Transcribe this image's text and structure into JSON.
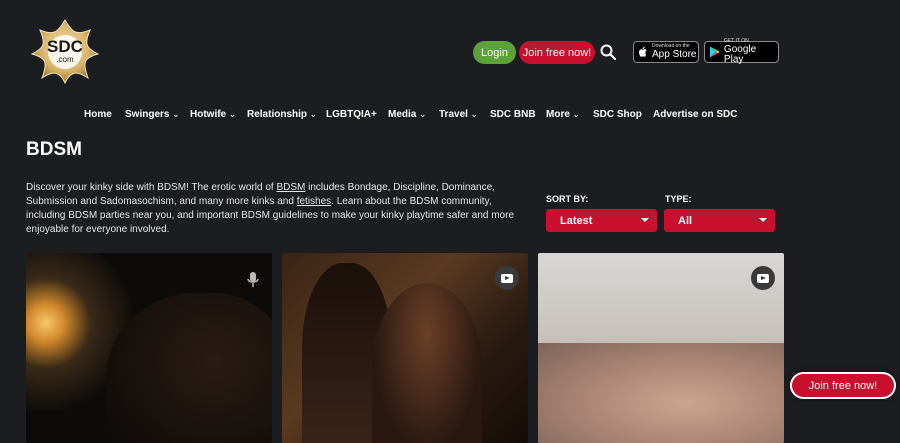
{
  "header": {
    "logo_text": "SDC",
    "logo_sub": ".com",
    "login_label": "Login",
    "join_label": "Join free now!",
    "app_store_small": "Download on the",
    "app_store_big": "App Store",
    "google_play_small": "GET IT ON",
    "google_play_big": "Google Play"
  },
  "nav": {
    "items": [
      {
        "label": "Home",
        "chevron": ""
      },
      {
        "label": "Swingers",
        "chevron": "⌄"
      },
      {
        "label": "Hotwife",
        "chevron": "⌄"
      },
      {
        "label": "Relationship",
        "chevron": "⌄"
      },
      {
        "label": "LGBTQIA+",
        "chevron": ""
      },
      {
        "label": "Media",
        "chevron": "⌄"
      },
      {
        "label": "Travel",
        "chevron": "⌄"
      },
      {
        "label": "SDC BNB",
        "chevron": ""
      },
      {
        "label": "More",
        "chevron": "⌄"
      },
      {
        "label": "SDC Shop",
        "chevron": ""
      },
      {
        "label": "Advertise on SDC",
        "chevron": ""
      }
    ]
  },
  "page": {
    "title": "BDSM",
    "intro_1": "Discover your kinky side with BDSM! The erotic world of ",
    "intro_link_1": "BDSM",
    "intro_2": " includes Bondage, Discipline, Dominance, Submission and Sadomasochism, and many more kinks and ",
    "intro_link_2": "fetishes",
    "intro_3": ". Learn about the BDSM community, including BDSM parties near you, and important BDSM guidelines to make your kinky playtime safer and more enjoyable for everyone involved."
  },
  "filters": {
    "sort_label": "SORT BY:",
    "sort_value": "Latest",
    "type_label": "TYPE:",
    "type_value": "All"
  },
  "cards": [
    {
      "media_icon": "microphone-icon"
    },
    {
      "media_icon": "video-icon"
    },
    {
      "media_icon": "video-icon"
    }
  ],
  "floating": {
    "join_label": "Join free now!"
  },
  "colors": {
    "background": "#1c1d21",
    "accent_red": "#c8102e",
    "login_green": "#5ba23a"
  }
}
